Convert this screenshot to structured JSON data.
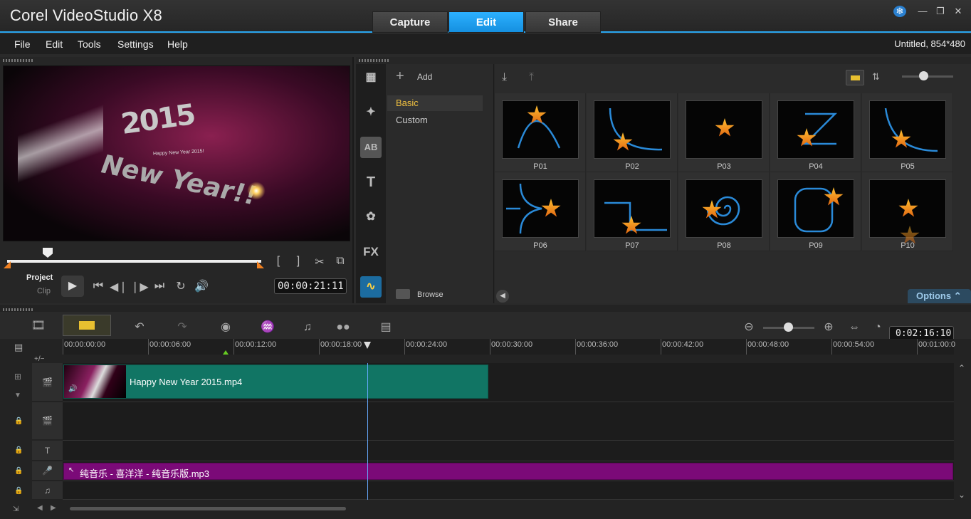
{
  "app": {
    "title": "Corel  VideoStudio X8"
  },
  "tabs": [
    {
      "label": "Capture"
    },
    {
      "label": "Edit"
    },
    {
      "label": "Share"
    }
  ],
  "menu": {
    "items": [
      "File",
      "Edit",
      "Tools",
      "Settings",
      "Help"
    ],
    "project_info": "Untitled, 854*480"
  },
  "player": {
    "mode_project": "Project",
    "mode_clip": "Clip",
    "timecode": "00:00:21:11",
    "scrub_position": 0.16
  },
  "library": {
    "add_label": "Add",
    "categories": [
      {
        "label": "Basic",
        "selected": true
      },
      {
        "label": "Custom",
        "selected": false
      }
    ],
    "browse_label": "Browse",
    "thumbnails": [
      "P01",
      "P02",
      "P03",
      "P04",
      "P05",
      "P06",
      "P07",
      "P08",
      "P09",
      "P10"
    ],
    "options_label": "Options",
    "tool_labels": {
      "title": "AB",
      "text": "T",
      "fx": "FX"
    }
  },
  "timeline": {
    "total_time": "0:02:16:10",
    "ruler_ticks": [
      "00:00:00:00",
      "00:00:06:00",
      "00:00:12:00",
      "00:00:18:00",
      "00:00:24:00",
      "00:00:30:00",
      "00:00:36:00",
      "00:00:42:00",
      "00:00:48:00",
      "00:00:54:00",
      "00:01:00:0"
    ],
    "video_clip": "Happy New Year 2015.mp4",
    "audio_clip": "纯音乐 - 喜洋洋 - 纯音乐版.mp3",
    "add_remove": "+/−"
  },
  "preview": {
    "headline": "2015",
    "subline": "New Year!!",
    "tagline": "Happy New Year 2015!"
  },
  "colors": {
    "accent": "#2aa8f2",
    "video_clip": "#117564",
    "audio_clip": "#7b0a78",
    "selected_category": "#f0c040"
  }
}
